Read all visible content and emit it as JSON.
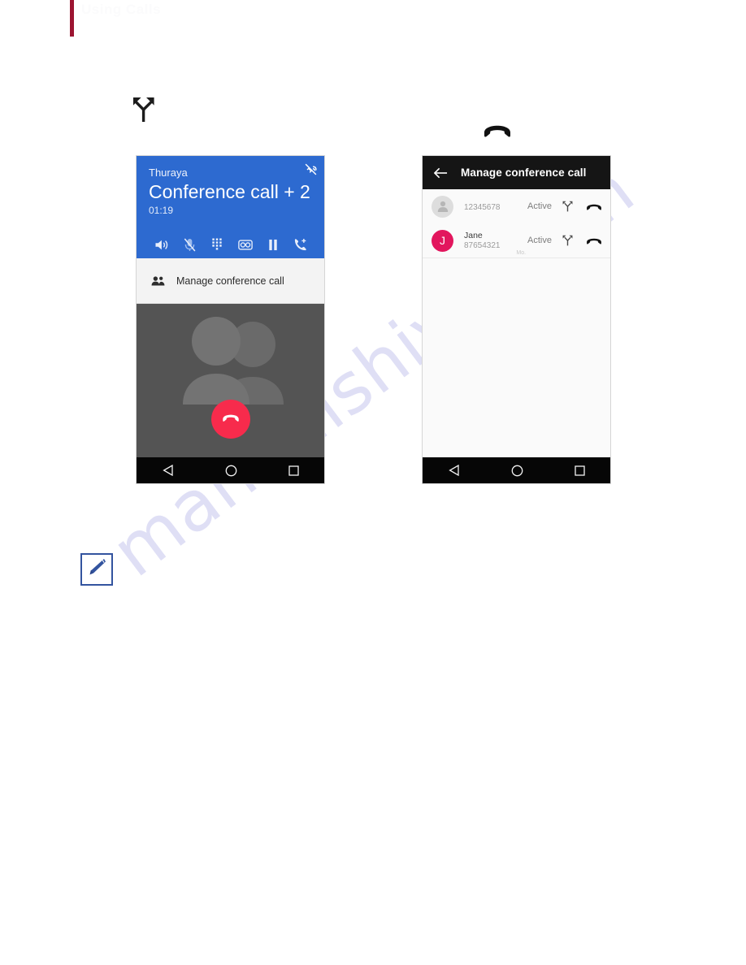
{
  "page": {
    "header_title": "Using Calls",
    "accent_color": "#9c1431",
    "watermark": "manualshive.com"
  },
  "inline_icons": {
    "split_call": "split-call-icon",
    "end_call": "end-call-icon"
  },
  "left_phone": {
    "call": {
      "carrier": "Thuraya",
      "title": "Conference call  + 2",
      "timer": "01:19",
      "satellite_icon": "satellite-off-icon",
      "background_color": "#2d6ad0",
      "actions": [
        {
          "name": "speaker-icon",
          "label": "Speaker"
        },
        {
          "name": "mute-off-icon",
          "label": "Mute"
        },
        {
          "name": "dialpad-icon",
          "label": "Keypad"
        },
        {
          "name": "voicemail-icon",
          "label": "Voicemail"
        },
        {
          "name": "pause-icon",
          "label": "Hold"
        },
        {
          "name": "add-call-icon",
          "label": "Add call"
        }
      ]
    },
    "manage_row": {
      "icon": "people-icon",
      "label": "Manage conference call"
    },
    "backdrop": {
      "people_icon": "conference-people-icon",
      "end_call_icon": "end-call-icon",
      "end_call_color": "#f72b4c",
      "background_color": "#545454"
    },
    "nav_bar": {
      "back": "back-triangle-icon",
      "home": "home-circle-icon",
      "recents": "recents-square-icon"
    }
  },
  "right_phone": {
    "app_bar": {
      "back_icon": "arrow-back-icon",
      "title": "Manage conference call"
    },
    "participants": [
      {
        "avatar_type": "placeholder",
        "avatar_initial": "",
        "avatar_color": "#dddddd",
        "name": "",
        "number": "12345678",
        "number_type": "",
        "status": "Active",
        "split_icon": "split-call-icon",
        "end_icon": "end-call-icon"
      },
      {
        "avatar_type": "initial",
        "avatar_initial": "J",
        "avatar_color": "#e2165d",
        "name": "Jane",
        "number": "87654321",
        "number_type": "Mo.",
        "status": "Active",
        "split_icon": "split-call-icon",
        "end_icon": "end-call-icon"
      }
    ],
    "nav_bar": {
      "back": "back-triangle-icon",
      "home": "home-circle-icon",
      "recents": "recents-square-icon"
    }
  },
  "note": {
    "icon": "note-pencil-icon",
    "border_color": "#33549f"
  }
}
